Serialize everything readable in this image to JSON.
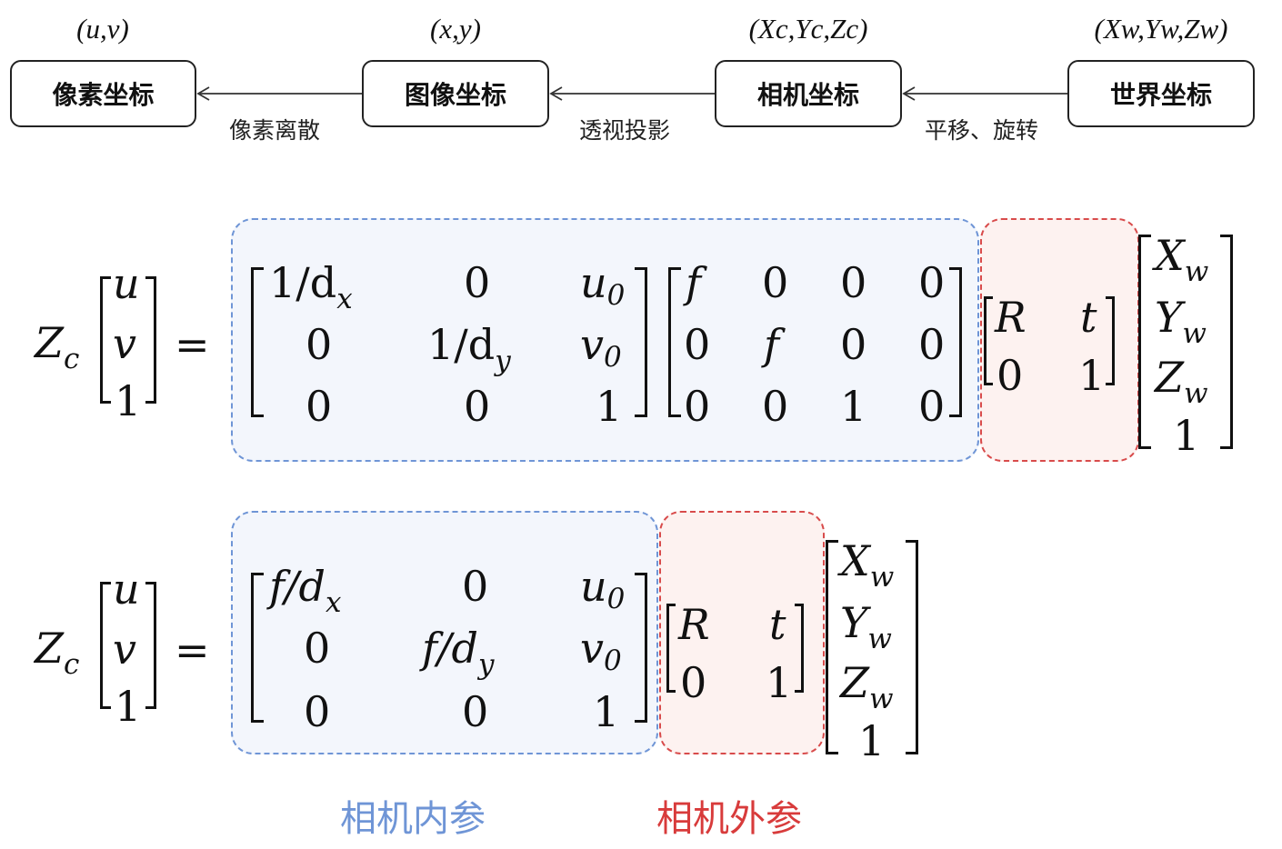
{
  "pipeline": {
    "nodes": [
      {
        "label": "像素坐标",
        "coords": "(u,v)"
      },
      {
        "label": "图像坐标",
        "coords": "(x,y)"
      },
      {
        "label": "相机坐标",
        "coords": "(Xc,Yc,Zc)"
      },
      {
        "label": "世界坐标",
        "coords": "(Xw,Yw,Zw)"
      }
    ],
    "edges": [
      {
        "label": "像素离散"
      },
      {
        "label": "透视投影"
      },
      {
        "label": "平移、旋转"
      }
    ]
  },
  "equation1": {
    "lhs": {
      "scale": "Z",
      "scale_sub": "c",
      "vector": [
        "u",
        "v",
        "1"
      ]
    },
    "equals": "=",
    "intrinsic_matrix": [
      [
        "1/d",
        "x",
        "0",
        "",
        "u",
        "0"
      ],
      [
        "0",
        "",
        "1/d",
        "y",
        "v",
        "0"
      ],
      [
        "0",
        "",
        "0",
        "",
        "1",
        ""
      ]
    ],
    "projection_matrix": [
      [
        "f",
        "0",
        "0",
        "0"
      ],
      [
        "0",
        "f",
        "0",
        "0"
      ],
      [
        "0",
        "0",
        "1",
        "0"
      ]
    ],
    "extrinsic_matrix": [
      [
        "R",
        "t"
      ],
      [
        "0",
        "1"
      ]
    ],
    "world_vector": [
      {
        "base": "X",
        "sub": "w"
      },
      {
        "base": "Y",
        "sub": "w"
      },
      {
        "base": "Z",
        "sub": "w"
      },
      {
        "base": "1",
        "sub": ""
      }
    ]
  },
  "equation2": {
    "lhs": {
      "scale": "Z",
      "scale_sub": "c",
      "vector": [
        "u",
        "v",
        "1"
      ]
    },
    "equals": "=",
    "intrinsic_matrix": [
      [
        "f/d",
        "x",
        "0",
        "",
        "u",
        "0"
      ],
      [
        "0",
        "",
        "f/d",
        "y",
        "v",
        "0"
      ],
      [
        "0",
        "",
        "0",
        "",
        "1",
        ""
      ]
    ],
    "extrinsic_matrix": [
      [
        "R",
        "t"
      ],
      [
        "0",
        "1"
      ]
    ],
    "world_vector": [
      {
        "base": "X",
        "sub": "w"
      },
      {
        "base": "Y",
        "sub": "w"
      },
      {
        "base": "Z",
        "sub": "w"
      },
      {
        "base": "1",
        "sub": ""
      }
    ]
  },
  "captions": {
    "intrinsic": "相机内参",
    "extrinsic": "相机外参"
  },
  "colors": {
    "intrinsic_border": "#6f95d6",
    "intrinsic_fill": "#f3f6fc",
    "extrinsic_border": "#d84b4b",
    "extrinsic_fill": "#fdf2f0",
    "intrinsic_caption": "#6f95d6",
    "extrinsic_caption": "#d83b3b"
  }
}
